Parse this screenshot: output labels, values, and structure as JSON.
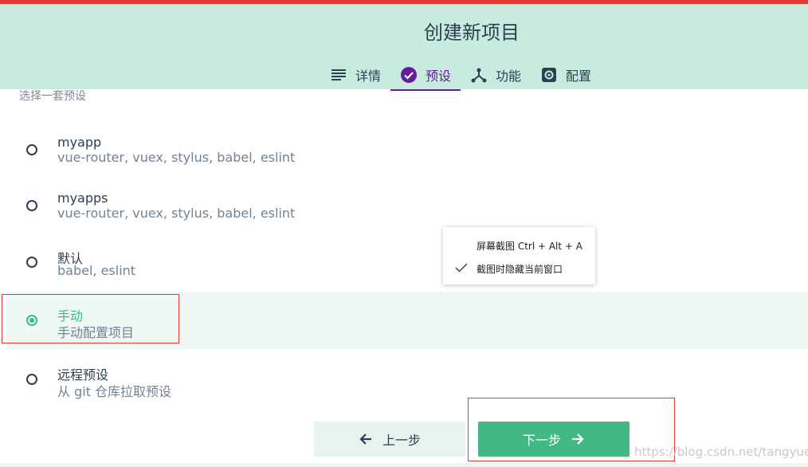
{
  "header": {
    "title": "创建新项目",
    "tabs": [
      {
        "label": "详情",
        "icon": "list-icon",
        "active": false
      },
      {
        "label": "预设",
        "icon": "check-circle-icon",
        "active": true
      },
      {
        "label": "功能",
        "icon": "fork-icon",
        "active": false
      },
      {
        "label": "配置",
        "icon": "gear-icon",
        "active": false
      }
    ]
  },
  "section_hint": "选择一套预设",
  "presets": [
    {
      "name": "myapp",
      "desc": "vue-router, vuex, stylus, babel, eslint",
      "selected": false
    },
    {
      "name": "myapps",
      "desc": "vue-router, vuex, stylus, babel, eslint",
      "selected": false
    },
    {
      "name": "默认",
      "desc": "babel, eslint",
      "selected": false
    },
    {
      "name": "手动",
      "desc": "手动配置项目",
      "selected": true
    },
    {
      "name": "远程预设",
      "desc": "从 git 仓库拉取预设",
      "selected": false
    }
  ],
  "context_menu": {
    "items": [
      {
        "label": "屏幕截图 Ctrl + Alt + A",
        "checked": false
      },
      {
        "label": "截图时隐藏当前窗口",
        "checked": true
      }
    ]
  },
  "buttons": {
    "back": "上一步",
    "next": "下一步"
  },
  "watermark": "https://blog.csdn.net/tangyuer",
  "colors": {
    "accent": "#42b983",
    "header_bg": "#c8ebe0",
    "active_tab": "#6a1b9a",
    "highlight": "#e53935"
  }
}
